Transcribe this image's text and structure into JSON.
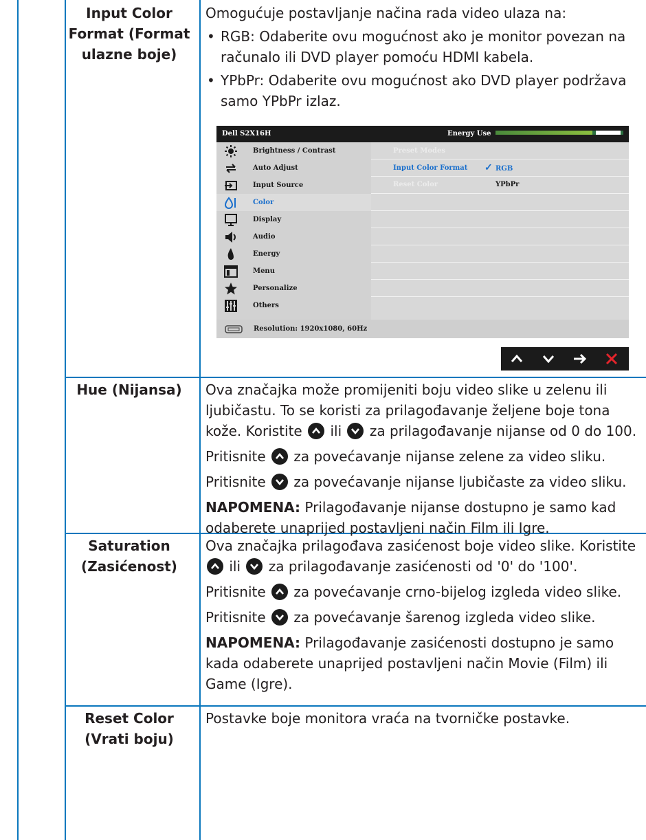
{
  "rows": [
    {
      "label": "Input Color Format (Format ulazne boje)",
      "intro": "Omogućuje postavljanje načina rada video ulaza na:",
      "bullets": [
        "RGB: Odaberite ovu mogućnost ako je monitor povezan na računalo ili DVD player pomoću HDMI kabela.",
        "YPbPr: Odaberite ovu mogućnost ako DVD player podržava samo YPbPr izlaz."
      ]
    },
    {
      "label": "Hue (Nijansa)",
      "p1_a": "Ova značajka može promijeniti boju video slike u zelenu ili ljubičastu. To se koristi za prilagođavanje željene boje tona kože. Koristite",
      "p1_mid": "ili",
      "p1_b": "za prilagođavanje nijanse od 0 do 100.",
      "p2_a": "Pritisnite",
      "p2_b": "za povećavanje nijanse zelene za video sliku.",
      "p3_a": "Pritisnite",
      "p3_b": "za povećavanje nijanse ljubičaste za video sliku.",
      "note_label": "NAPOMENA:",
      "note_text": "Prilagođavanje nijanse dostupno je samo kad odaberete unaprijed postavljeni način Film ili Igre."
    },
    {
      "label": "Saturation (Zasićenost)",
      "p1_a": "Ova značajka prilagođava zasićenost boje video slike. Koristite",
      "p1_mid": "ili",
      "p1_b": "za prilagođavanje zasićenosti od '0' do '100'.",
      "p2_a": "Pritisnite",
      "p2_b": "za povećavanje crno-bijelog izgleda video slike.",
      "p3_a": "Pritisnite",
      "p3_b": "za povećavanje šarenog izgleda video slike.",
      "note_label": "NAPOMENA:",
      "note_text": "Prilagođavanje zasićenosti dostupno je samo kada odaberete unaprijed postavljeni način Movie (Film) ili Game (Igre)."
    },
    {
      "label": "Reset Color (Vrati boju)",
      "text": "Postavke boje monitora vraća na tvorničke postavke."
    }
  ],
  "osd": {
    "title": "Dell S2X16H",
    "energy_label": "Energy Use",
    "energy_level": 0.78,
    "menu": [
      {
        "label": "Brightness / Contrast",
        "icon": "brightness-icon"
      },
      {
        "label": "Auto Adjust",
        "icon": "auto-adjust-icon"
      },
      {
        "label": "Input Source",
        "icon": "input-source-icon"
      },
      {
        "label": "Color",
        "icon": "color-icon",
        "selected": true
      },
      {
        "label": "Display",
        "icon": "display-icon"
      },
      {
        "label": "Audio",
        "icon": "audio-icon"
      },
      {
        "label": "Energy",
        "icon": "energy-icon"
      },
      {
        "label": "Menu",
        "icon": "menu-icon"
      },
      {
        "label": "Personalize",
        "icon": "personalize-icon"
      },
      {
        "label": "Others",
        "icon": "others-icon"
      }
    ],
    "options": {
      "preset_modes": "Preset Modes",
      "input_color_format": "Input Color Format",
      "reset_color": "Reset Color",
      "choice_rgb": "RGB",
      "choice_ypbpr": "YPbPr",
      "check": "✓"
    },
    "resolution": "Resolution: 1920x1080, 60Hz",
    "accent": "#1a6fcc"
  },
  "colors": {
    "rule": "#0a77bd",
    "text": "#231f20"
  }
}
